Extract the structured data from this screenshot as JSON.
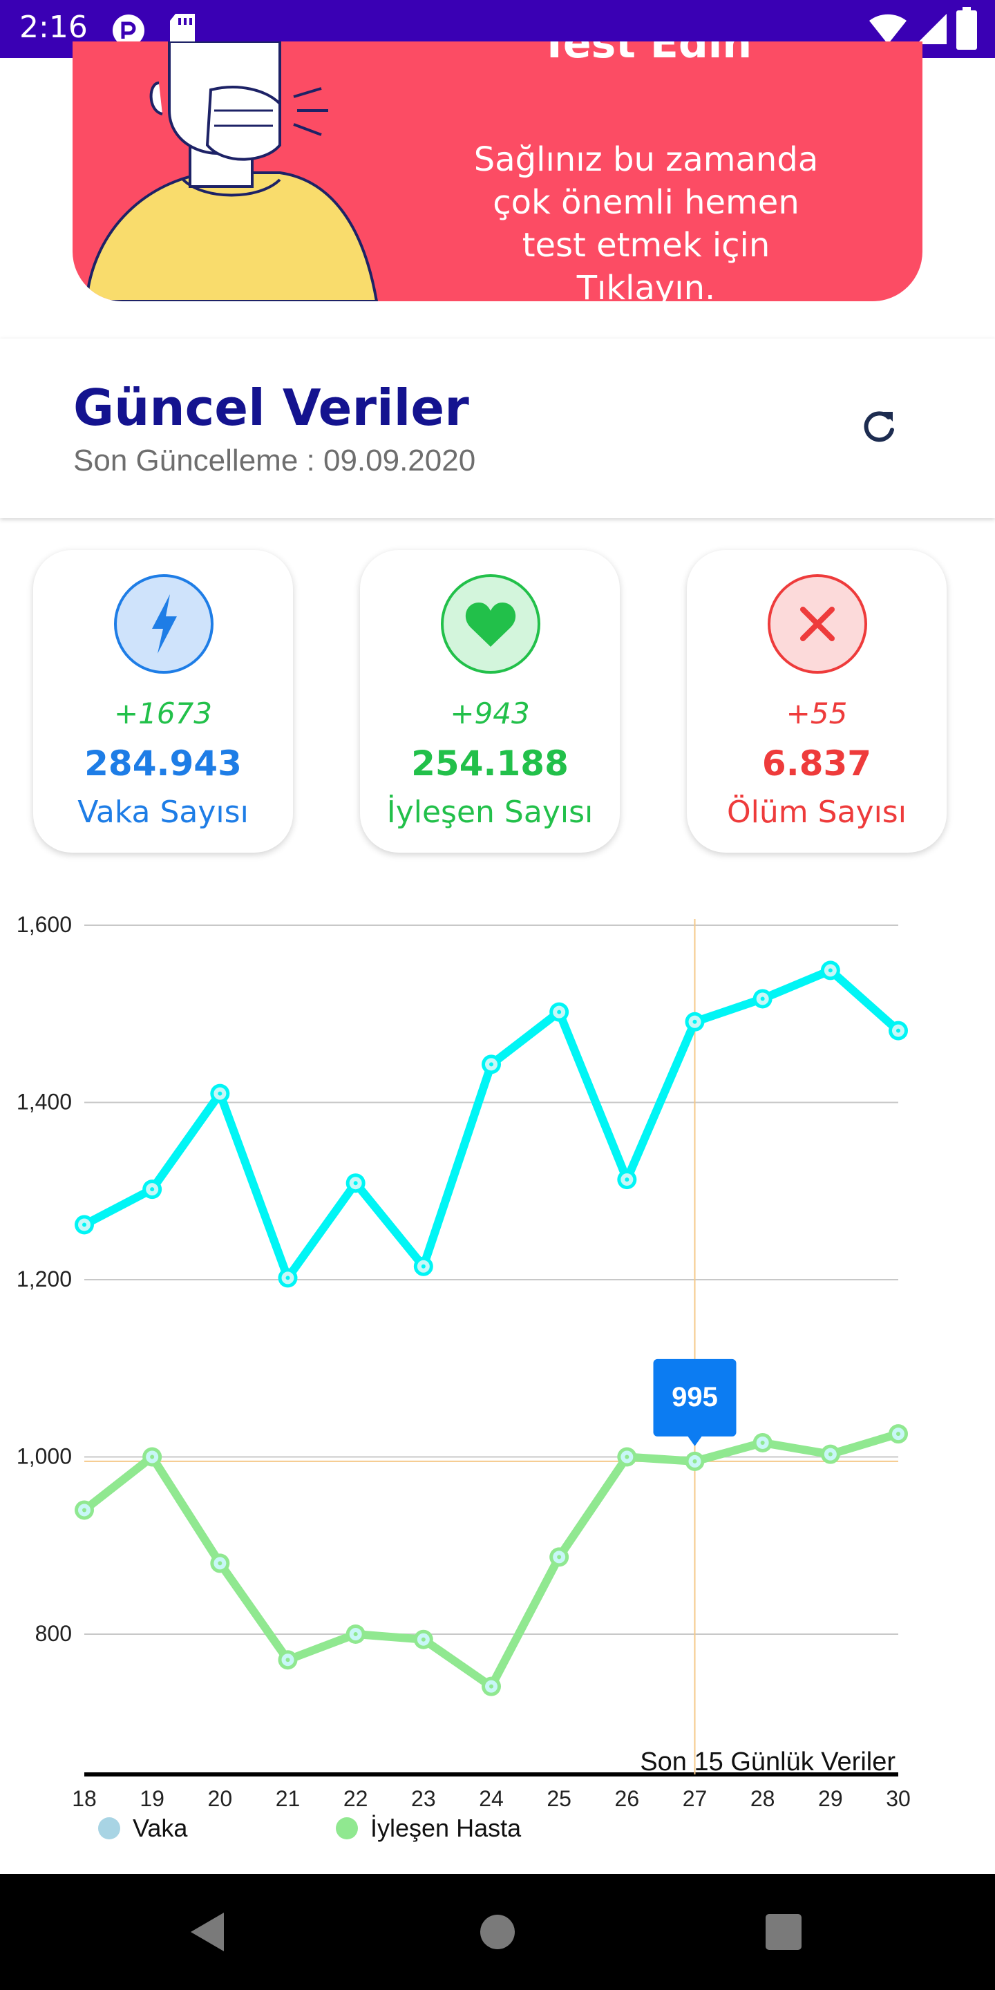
{
  "status_bar": {
    "time": "2:16"
  },
  "banner": {
    "title": "Test Edin",
    "text": "Sağlınız bu zamanda çok önemli hemen test etmek için Tıklayın."
  },
  "update": {
    "title": "Güncel Veriler",
    "subtitle": "Son Güncelleme : 09.09.2020"
  },
  "stats": [
    {
      "delta": "+1673",
      "value": "284.943",
      "label": "Vaka Sayısı",
      "color": "#1e7de6",
      "icon": "lightning-icon"
    },
    {
      "delta": "+943",
      "value": "254.188",
      "label": "İyleşen Sayısı",
      "color": "#22c04a",
      "icon": "heart-icon"
    },
    {
      "delta": "+55",
      "value": "6.837",
      "label": "Ölüm Sayısı",
      "color": "#ee3b3b",
      "icon": "close-icon"
    }
  ],
  "chart_data": {
    "type": "line",
    "x": [
      "18",
      "19",
      "20",
      "21",
      "22",
      "23",
      "24",
      "25",
      "26",
      "27",
      "28",
      "29",
      "30"
    ],
    "series": [
      {
        "name": "Vaka",
        "color": "#00f5f5",
        "values": [
          1262,
          1302,
          1410,
          1202,
          1309,
          1215,
          1443,
          1502,
          1313,
          1491,
          1517,
          1549,
          1481
        ]
      },
      {
        "name": "İyleşen Hasta",
        "color": "#90e890",
        "values": [
          940,
          1000,
          880,
          771,
          800,
          794,
          741,
          887,
          1000,
          995,
          1016,
          1003,
          1026
        ]
      }
    ],
    "y_ticks": [
      "800",
      "1,000",
      "1,200",
      "1,400",
      "1,600"
    ],
    "y_tick_values": [
      800,
      1000,
      1200,
      1400,
      1600
    ],
    "ylim": [
      670,
      1650
    ],
    "label": "Son 15 Günlük Veriler",
    "tooltip": {
      "x": "27",
      "value": "995"
    },
    "legend_placement": "bottom-left",
    "grid": true
  }
}
